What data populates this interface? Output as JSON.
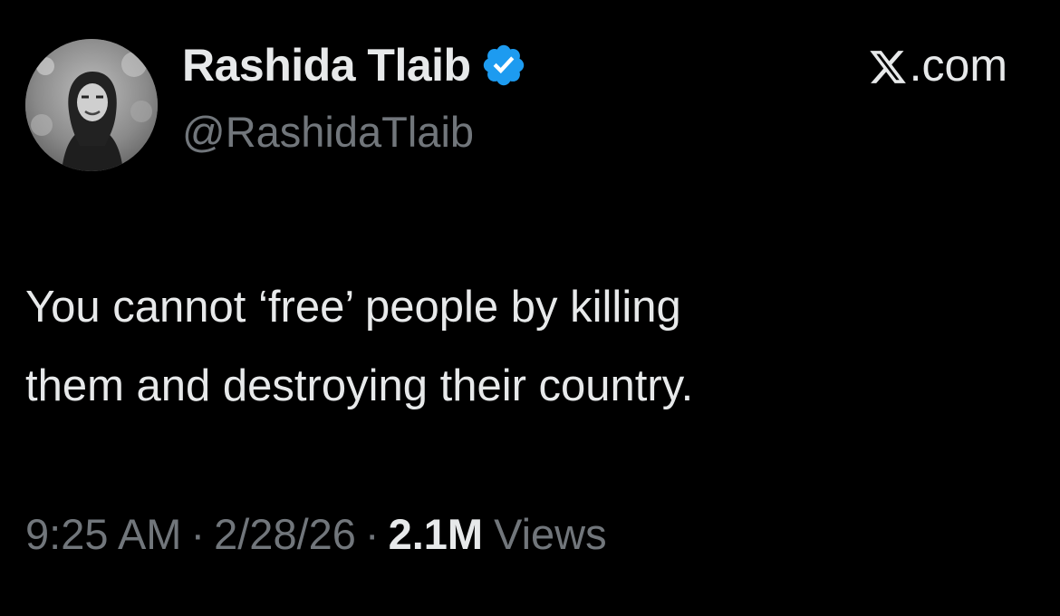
{
  "author": {
    "display_name": "Rashida Tlaib",
    "handle": "@RashidaTlaib",
    "verified": true,
    "verified_badge_icon": "verified-badge-icon",
    "verified_color": "#1d9bf0",
    "avatar_icon": "profile-avatar"
  },
  "brand": {
    "icon": "x-logo-icon",
    "domain_suffix": ".com"
  },
  "tweet": {
    "text": "You cannot ‘free’ people by killing\nthem and destroying their country."
  },
  "meta": {
    "time": "9:25 AM",
    "separator": "·",
    "date": "2/28/26",
    "views_count": "2.1M",
    "views_label": "Views"
  },
  "colors": {
    "background": "#000000",
    "primary_text": "#e7e9ea",
    "secondary_text": "#71767b"
  }
}
